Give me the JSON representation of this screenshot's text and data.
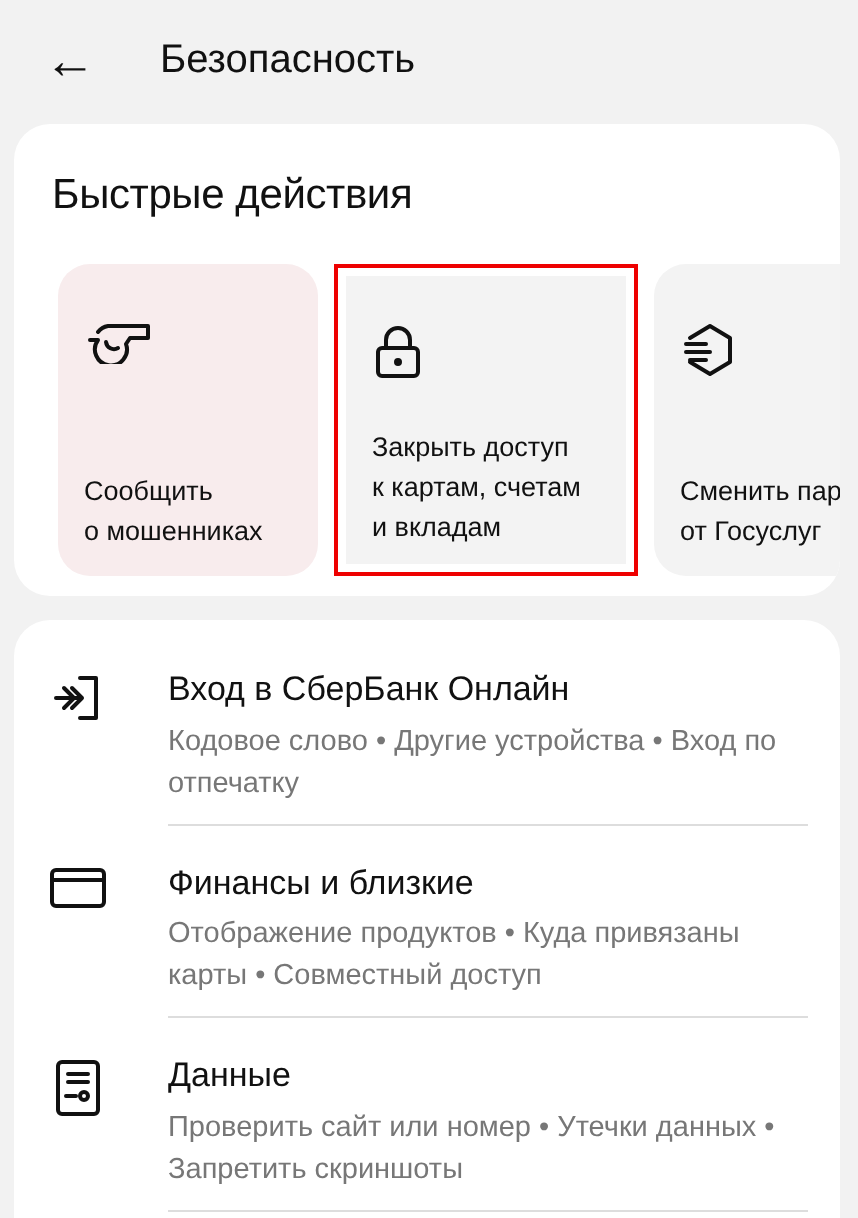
{
  "header": {
    "back": "←",
    "title": "Безопасность"
  },
  "quick_actions": {
    "title": "Быстрые действия",
    "cards": [
      {
        "kind": "whistle",
        "label": "Сообщить\nо мошенниках",
        "color": "#f8eced",
        "highlighted": false
      },
      {
        "kind": "lock",
        "label": "Закрыть доступ\nк картам, счетам\nи вкладам",
        "color": "#f3f3f3",
        "highlighted": true
      },
      {
        "kind": "hexagon",
        "label": "Сменить пар\nот Госуслуг",
        "color": "#f3f3f3",
        "highlighted": false
      }
    ]
  },
  "menu": [
    {
      "kind": "login",
      "title": "Вход в СберБанк Онлайн",
      "subtitle": "Кодовое слово • Другие устройства • Вход по отпечатку"
    },
    {
      "kind": "card",
      "title": "Финансы и близкие",
      "subtitle": "Отображение продуктов • Куда привязаны карты • Совместный доступ"
    },
    {
      "kind": "document",
      "title": "Данные",
      "subtitle": "Проверить сайт или номер • Утечки данных • Запретить скриншоты"
    }
  ]
}
